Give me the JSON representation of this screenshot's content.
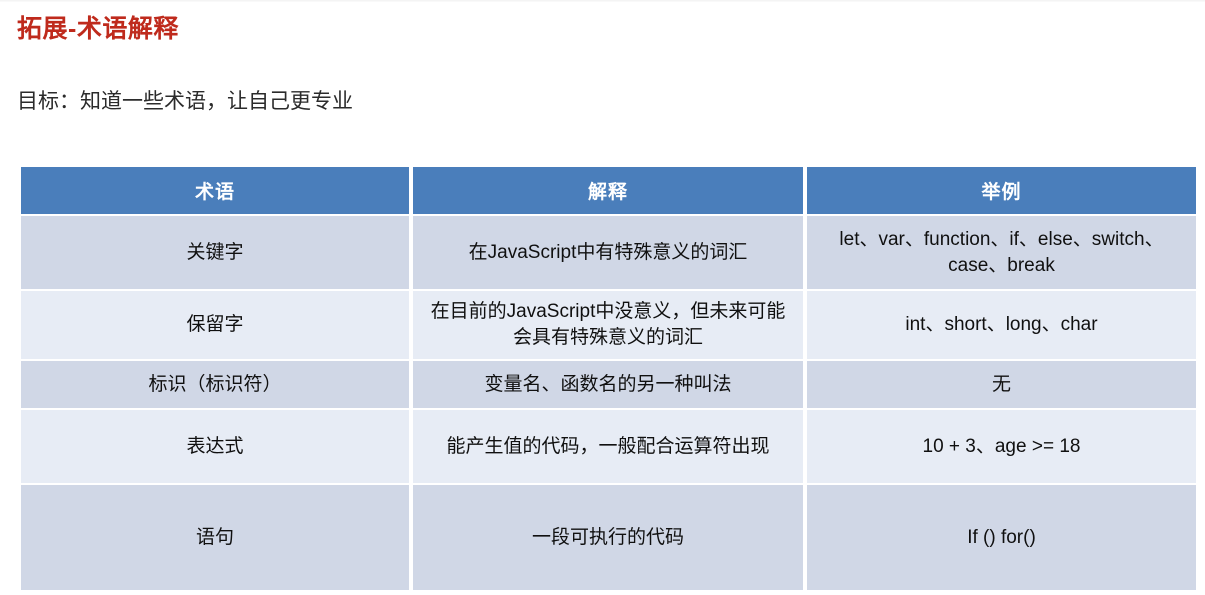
{
  "slide": {
    "title": "拓展-术语解释",
    "subtitle": "目标：知道一些术语，让自己更专业",
    "title_color": "#bf2a1c",
    "header_color": "#4a7ebb",
    "row_shade_dark": "#d0d7e6",
    "row_shade_light": "#e7ecf5"
  },
  "table": {
    "headers": [
      "术语",
      "解释",
      "举例"
    ],
    "rows": [
      {
        "term": "关键字",
        "explanation": "在JavaScript中有特殊意义的词汇",
        "example": "let、var、function、if、else、switch、case、break"
      },
      {
        "term": "保留字",
        "explanation": "在目前的JavaScript中没意义，但未来可能会具有特殊意义的词汇",
        "example": "int、short、long、char"
      },
      {
        "term": "标识（标识符）",
        "explanation": "变量名、函数名的另一种叫法",
        "example": "无"
      },
      {
        "term": "表达式",
        "explanation": "能产生值的代码，一般配合运算符出现",
        "example": "10 + 3、age >= 18"
      },
      {
        "term": "语句",
        "explanation": "一段可执行的代码",
        "example": "If ()  for()"
      }
    ]
  }
}
